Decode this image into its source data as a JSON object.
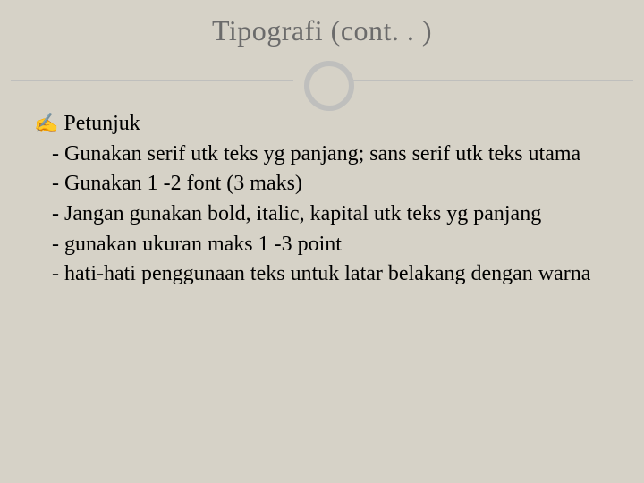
{
  "slide": {
    "title": "Tipografi (cont. . )",
    "bullet": {
      "icon": "✍",
      "label": "Petunjuk"
    },
    "items": [
      "- Gunakan serif utk teks yg panjang; sans serif utk teks utama",
      "- Gunakan 1 -2 font (3 maks)",
      "- Jangan gunakan bold, italic, kapital utk teks yg panjang",
      "- gunakan ukuran maks 1 -3 point",
      "- hati-hati penggunaan teks untuk latar belakang dengan warna"
    ]
  }
}
